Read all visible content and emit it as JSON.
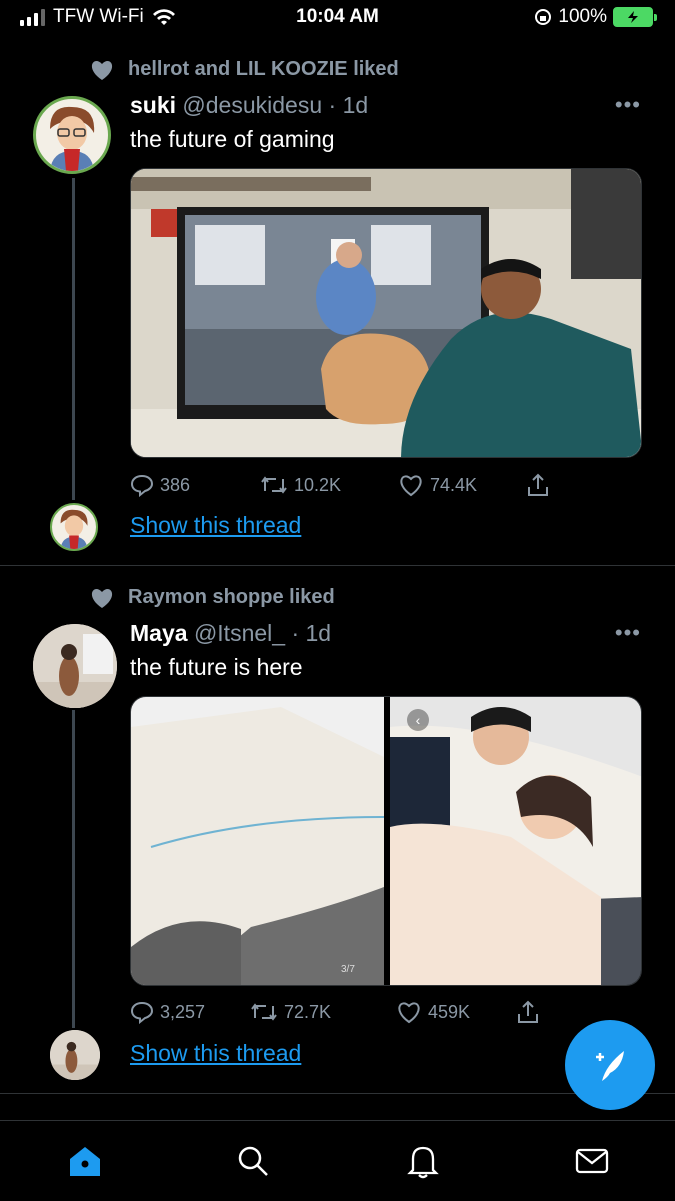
{
  "status_bar": {
    "carrier": "TFW Wi-Fi",
    "time": "10:04 AM",
    "battery": "100%"
  },
  "tweets": [
    {
      "social_context": "hellrot and LIL KOOZIE liked",
      "name": "suki",
      "handle": "@desukidesu",
      "time": "· 1d",
      "text": "the future of gaming",
      "stats": {
        "replies": "386",
        "retweets": "10.2K",
        "likes": "74.4K"
      },
      "show_thread": "Show this thread"
    },
    {
      "social_context": "Raymon shoppe liked",
      "name": "Maya",
      "handle": "@Itsnel_",
      "time": "· 1d",
      "text": "the future is here",
      "media_counter": "3/7",
      "stats": {
        "replies": "3,257",
        "retweets": "72.7K",
        "likes": "459K"
      },
      "show_thread": "Show this thread"
    }
  ],
  "colors": {
    "accent": "#1d9bf0",
    "muted": "#8b98a5",
    "background": "#000000"
  },
  "icons": [
    "heart-icon",
    "more-icon",
    "reply-icon",
    "retweet-icon",
    "like-icon",
    "share-icon",
    "home-icon",
    "search-icon",
    "notifications-icon",
    "messages-icon",
    "compose-icon"
  ]
}
